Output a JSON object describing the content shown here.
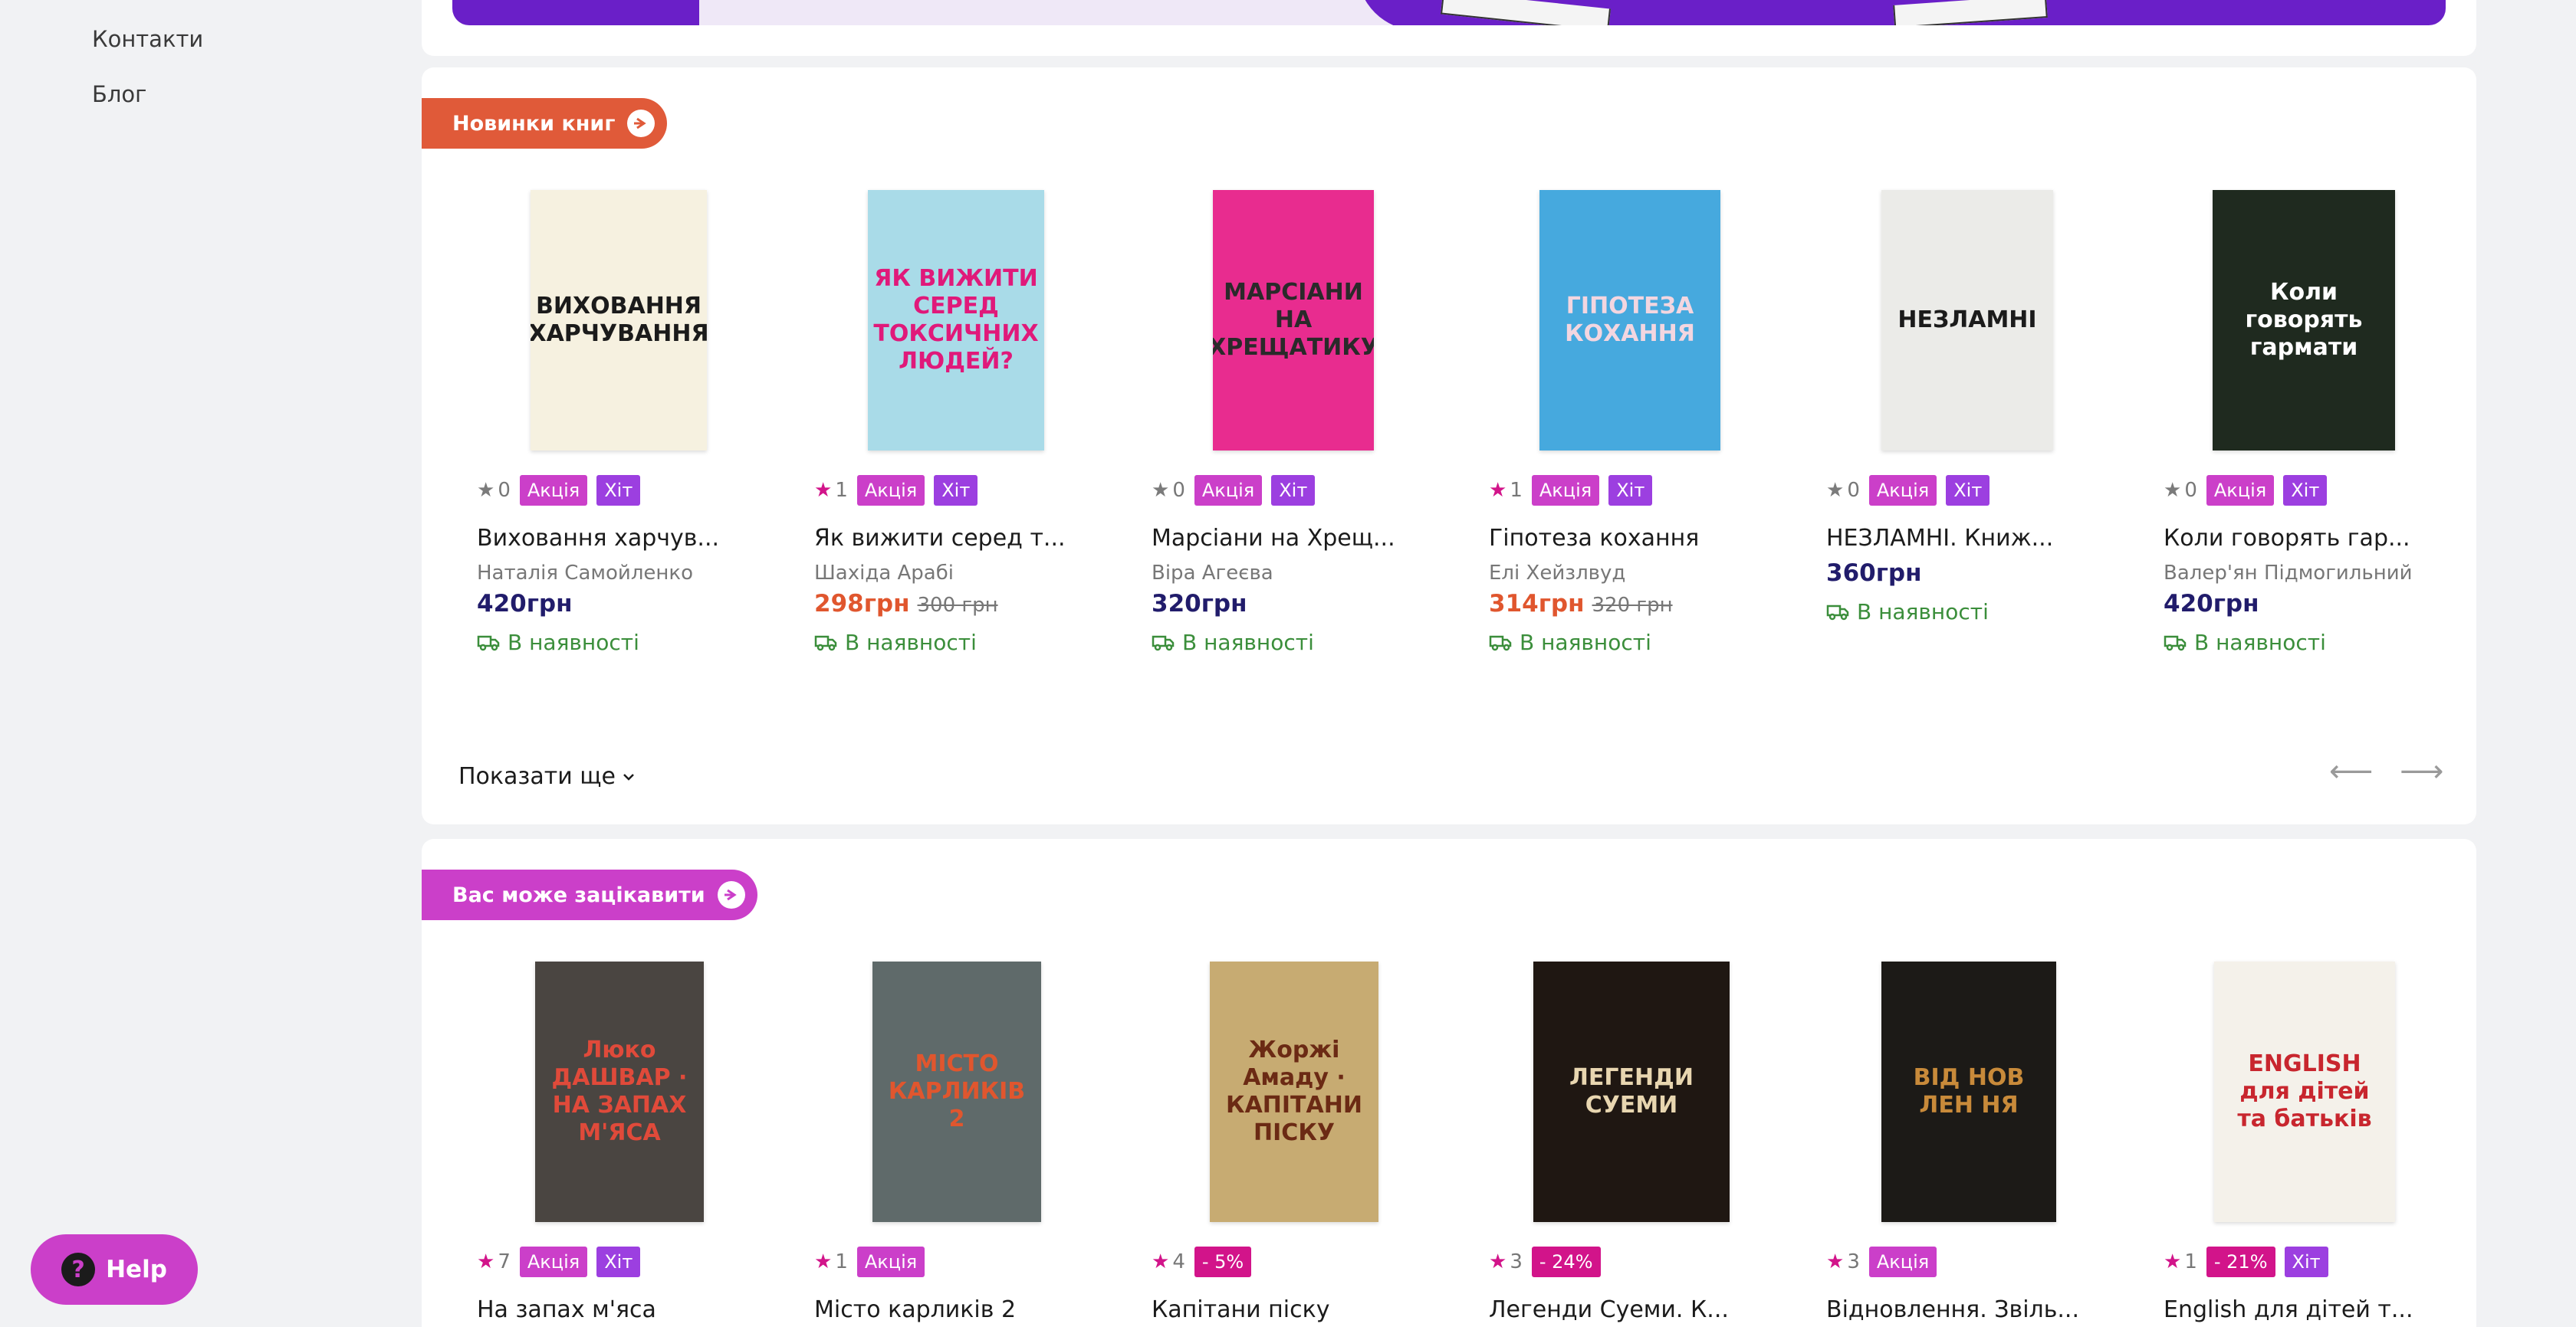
{
  "sidebar": {
    "links": [
      "Контакти",
      "Блог"
    ]
  },
  "colors": {
    "new_books_tag": "#e05a39",
    "interest_tag": "#cb3fc9",
    "sale_badge": "#cb3fc9",
    "hit_badge": "#9c3fe0",
    "price": "#211c6b",
    "discount_price": "#e0562e",
    "in_stock": "#3b8e3b"
  },
  "section_new": {
    "label": "Новинки книг",
    "show_more": "Показати ще",
    "books": [
      {
        "rating": "0",
        "rated": false,
        "badges": [
          {
            "text": "Акція",
            "type": "sale"
          },
          {
            "text": "Хіт",
            "type": "hit"
          }
        ],
        "title": "Виховання харчув...",
        "author": "Наталія Самойленко",
        "price": "420грн",
        "old_price": "",
        "stock": "В наявності",
        "cover_title": "ВИХОВАННЯ ХАРЧУВАННЯ",
        "cover_bg": "#f6f1e0",
        "cover_fg": "#1b1b1b"
      },
      {
        "rating": "1",
        "rated": true,
        "badges": [
          {
            "text": "Акція",
            "type": "sale"
          },
          {
            "text": "Хіт",
            "type": "hit"
          }
        ],
        "title": "Як вижити серед т...",
        "author": "Шахіда Арабі",
        "price": "298грн",
        "old_price": "300 грн",
        "stock": "В наявності",
        "cover_title": "ЯК ВИЖИТИ СЕРЕД ТОКСИЧНИХ ЛЮДЕЙ?",
        "cover_bg": "#a9dbe8",
        "cover_fg": "#e0197a"
      },
      {
        "rating": "0",
        "rated": false,
        "badges": [
          {
            "text": "Акція",
            "type": "sale"
          },
          {
            "text": "Хіт",
            "type": "hit"
          }
        ],
        "title": "Марсіани на Хрещ...",
        "author": "Віра Агеєва",
        "price": "320грн",
        "old_price": "",
        "stock": "В наявності",
        "cover_title": "МАРСІАНИ НА ХРЕЩАТИКУ",
        "cover_bg": "#e82c8f",
        "cover_fg": "#2a2a2a"
      },
      {
        "rating": "1",
        "rated": true,
        "badges": [
          {
            "text": "Акція",
            "type": "sale"
          },
          {
            "text": "Хіт",
            "type": "hit"
          }
        ],
        "title": "Гіпотеза кохання",
        "author": "Елі Хейзлвуд",
        "price": "314грн",
        "old_price": "320 грн",
        "stock": "В наявності",
        "cover_title": "ГІПОТЕЗА КОХАННЯ",
        "cover_bg": "#46a9de",
        "cover_fg": "#f3d6e0"
      },
      {
        "rating": "0",
        "rated": false,
        "badges": [
          {
            "text": "Акція",
            "type": "sale"
          },
          {
            "text": "Хіт",
            "type": "hit"
          }
        ],
        "title": "НЕЗЛАМНІ. Книж...",
        "author": "",
        "price": "360грн",
        "old_price": "",
        "stock": "В наявності",
        "cover_title": "НЕЗЛАМНІ",
        "cover_bg": "#ebebe8",
        "cover_fg": "#1b1b1b"
      },
      {
        "rating": "0",
        "rated": false,
        "badges": [
          {
            "text": "Акція",
            "type": "sale"
          },
          {
            "text": "Хіт",
            "type": "hit"
          }
        ],
        "title": "Коли говорять гар...",
        "author": "Валер'ян Підмогильний",
        "price": "420грн",
        "old_price": "",
        "stock": "В наявності",
        "cover_title": "Коли говорять гармати",
        "cover_bg": "#1f2a1f",
        "cover_fg": "#ffffff"
      }
    ]
  },
  "section_interest": {
    "label": "Вас може зацікавити",
    "books": [
      {
        "rating": "7",
        "rated": true,
        "badges": [
          {
            "text": "Акція",
            "type": "sale"
          },
          {
            "text": "Хіт",
            "type": "hit"
          }
        ],
        "title": "На запах м'яса",
        "cover_title": "Люко ДАШВАР · НА ЗАПАХ М'ЯСА",
        "cover_bg": "#4a4541",
        "cover_fg": "#e04a3a"
      },
      {
        "rating": "1",
        "rated": true,
        "badges": [
          {
            "text": "Акція",
            "type": "sale"
          }
        ],
        "title": "Місто карликів 2",
        "cover_title": "МІСТО КАРЛИКІВ 2",
        "cover_bg": "#5f6a6a",
        "cover_fg": "#e0562e"
      },
      {
        "rating": "4",
        "rated": true,
        "badges": [
          {
            "text": "- 5%",
            "type": "discount"
          }
        ],
        "title": "Капітани піску",
        "cover_title": "Жоржі Амаду · КАПІТАНИ ПІСКУ",
        "cover_bg": "#c7ab72",
        "cover_fg": "#6b2a14"
      },
      {
        "rating": "3",
        "rated": true,
        "badges": [
          {
            "text": "- 24%",
            "type": "discount"
          }
        ],
        "title": "Легенди Суеми. К...",
        "cover_title": "ЛЕГЕНДИ СУЕМИ",
        "cover_bg": "#1f1712",
        "cover_fg": "#e8d6b0"
      },
      {
        "rating": "3",
        "rated": true,
        "badges": [
          {
            "text": "Акція",
            "type": "sale"
          }
        ],
        "title": "Відновлення. Звіль...",
        "cover_title": "ВІД НОВ ЛЕН НЯ",
        "cover_bg": "#1c1a17",
        "cover_fg": "#c88a3a"
      },
      {
        "rating": "1",
        "rated": true,
        "badges": [
          {
            "text": "- 21%",
            "type": "discount"
          },
          {
            "text": "Хіт",
            "type": "hit"
          }
        ],
        "title": "English для дітей т...",
        "cover_title": "ENGLISH для дітей та батьків",
        "cover_bg": "#f4f1ea",
        "cover_fg": "#c8262e"
      }
    ]
  },
  "help": {
    "label": "Help"
  }
}
